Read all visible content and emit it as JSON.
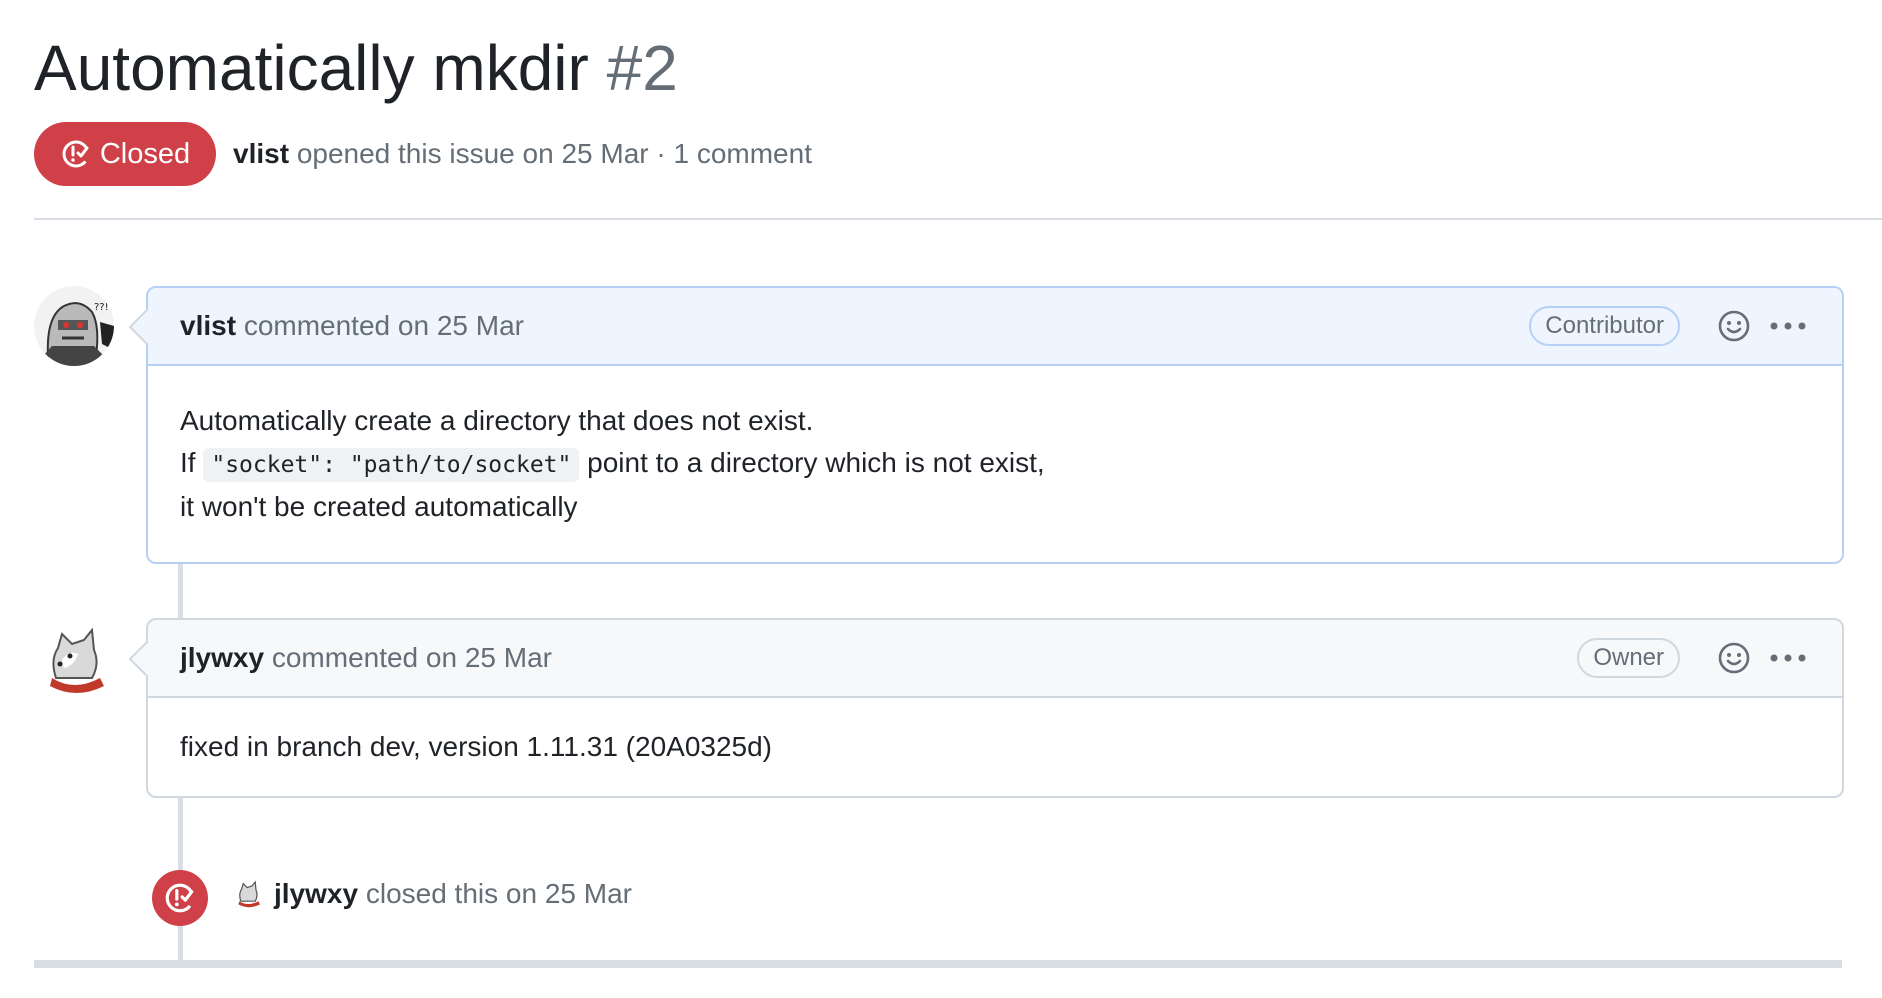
{
  "issue": {
    "title": "Automatically mkdir",
    "number": "#2",
    "status": "Closed",
    "author": "vlist",
    "opened_text": "opened this issue on 25 Mar · 1 comment"
  },
  "comments": [
    {
      "author": "vlist",
      "action": "commented",
      "date": "on 25 Mar",
      "role": "Contributor",
      "body": {
        "line1": "Automatically create a directory that does not exist.",
        "line2_prefix": "If",
        "code": "\"socket\": \"path/to/socket\"",
        "line2_suffix": "point to a directory which is not exist,",
        "line3": "it won't be created automatically"
      }
    },
    {
      "author": "jlywxy",
      "action": "commented",
      "date": "on 25 Mar",
      "role": "Owner",
      "body": {
        "line1": "fixed in branch dev, version 1.11.31 (20A0325d)"
      }
    }
  ],
  "event": {
    "author": "jlywxy",
    "action": "closed this",
    "date": "on 25 Mar"
  },
  "colors": {
    "closed": "#cf4048",
    "muted": "#656d76",
    "text": "#1f2328",
    "border": "#d0d7de",
    "author_header": "#eef5ff"
  },
  "icons": [
    "issue-closed-icon",
    "smiley-icon",
    "kebab-horizontal-icon"
  ]
}
